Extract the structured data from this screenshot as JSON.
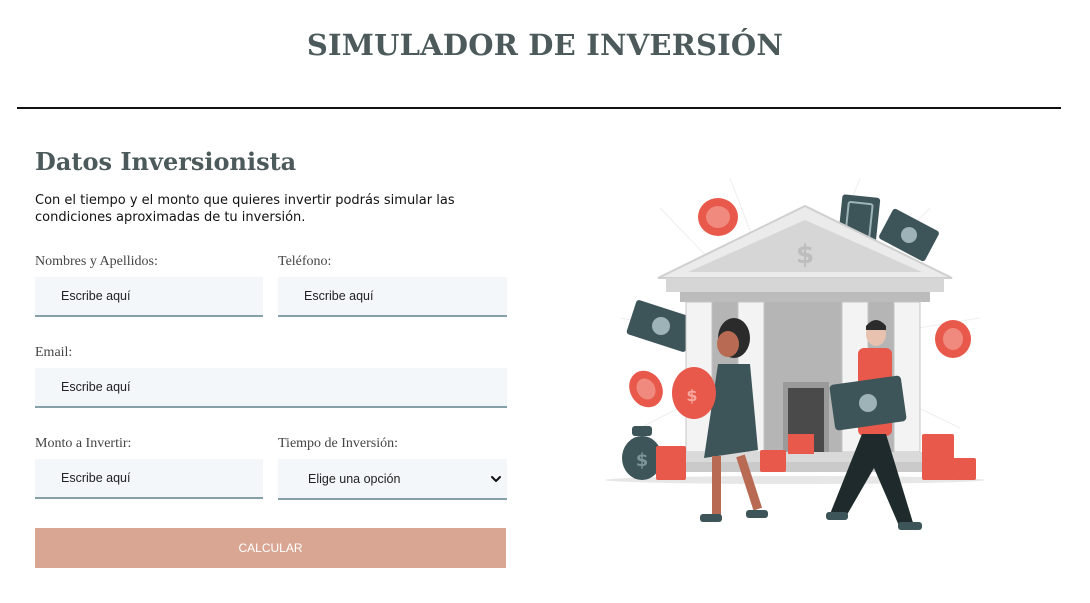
{
  "header": {
    "title": "SIMULADOR DE INVERSIÓN"
  },
  "form": {
    "section_title": "Datos Inversionista",
    "intro": "Con el tiempo y el monto que quieres invertir podrás simular las condiciones aproximadas de tu inversión.",
    "fields": {
      "nombres": {
        "label": "Nombres y Apellidos:",
        "placeholder": "Escribe aquí"
      },
      "telefono": {
        "label": "Teléfono:",
        "placeholder": "Escribe aquí"
      },
      "email": {
        "label": "Email:",
        "placeholder": "Escribe aquí"
      },
      "monto": {
        "label": "Monto a Invertir:",
        "placeholder": "Escribe aquí"
      },
      "tiempo": {
        "label": "Tiempo de Inversión:",
        "selected": "Elige una opción"
      }
    },
    "submit_label": "CALCULAR"
  },
  "illustration": {
    "subject": "bank building with investors carrying money",
    "colors": {
      "accent": "#e8584b",
      "teal": "#3d5559",
      "gray": "#c9c9c9"
    }
  },
  "colors": {
    "title": "#4c5a5c",
    "button": "#d8a692",
    "input_bg": "#f3f7fa",
    "input_border": "#86a0aa"
  }
}
